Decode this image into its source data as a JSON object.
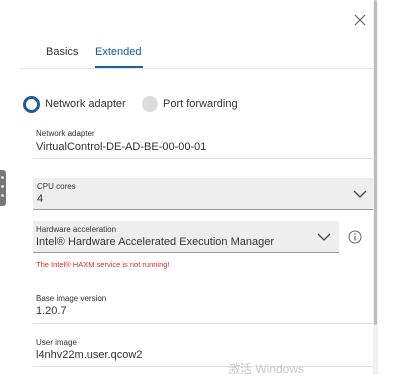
{
  "tabs": [
    {
      "label": "Basics",
      "active": false
    },
    {
      "label": "Extended",
      "active": true
    }
  ],
  "network_mode": {
    "options": [
      {
        "label": "Network adapter",
        "selected": true
      },
      {
        "label": "Port forwarding",
        "selected": false
      }
    ]
  },
  "network_adapter": {
    "label": "Network adapter",
    "value": "VirtualControl-DE-AD-BE-00-00-01"
  },
  "cpu_cores": {
    "label": "CPU cores",
    "value": "4"
  },
  "hardware_acceleration": {
    "label": "Hardware acceleration",
    "value": "Intel® Hardware Accelerated Execution Manager",
    "error": "The Intel® HAXM service is not running!"
  },
  "base_image_version": {
    "label": "Base image version",
    "value": "1.20.7"
  },
  "user_image": {
    "label": "User image",
    "value": "l4nhv22m.user.qcow2"
  },
  "watermark": "激活 Windows",
  "colors": {
    "accent": "#1f5c9c",
    "error": "#d32f2f",
    "select_bg": "#eeeeee"
  }
}
